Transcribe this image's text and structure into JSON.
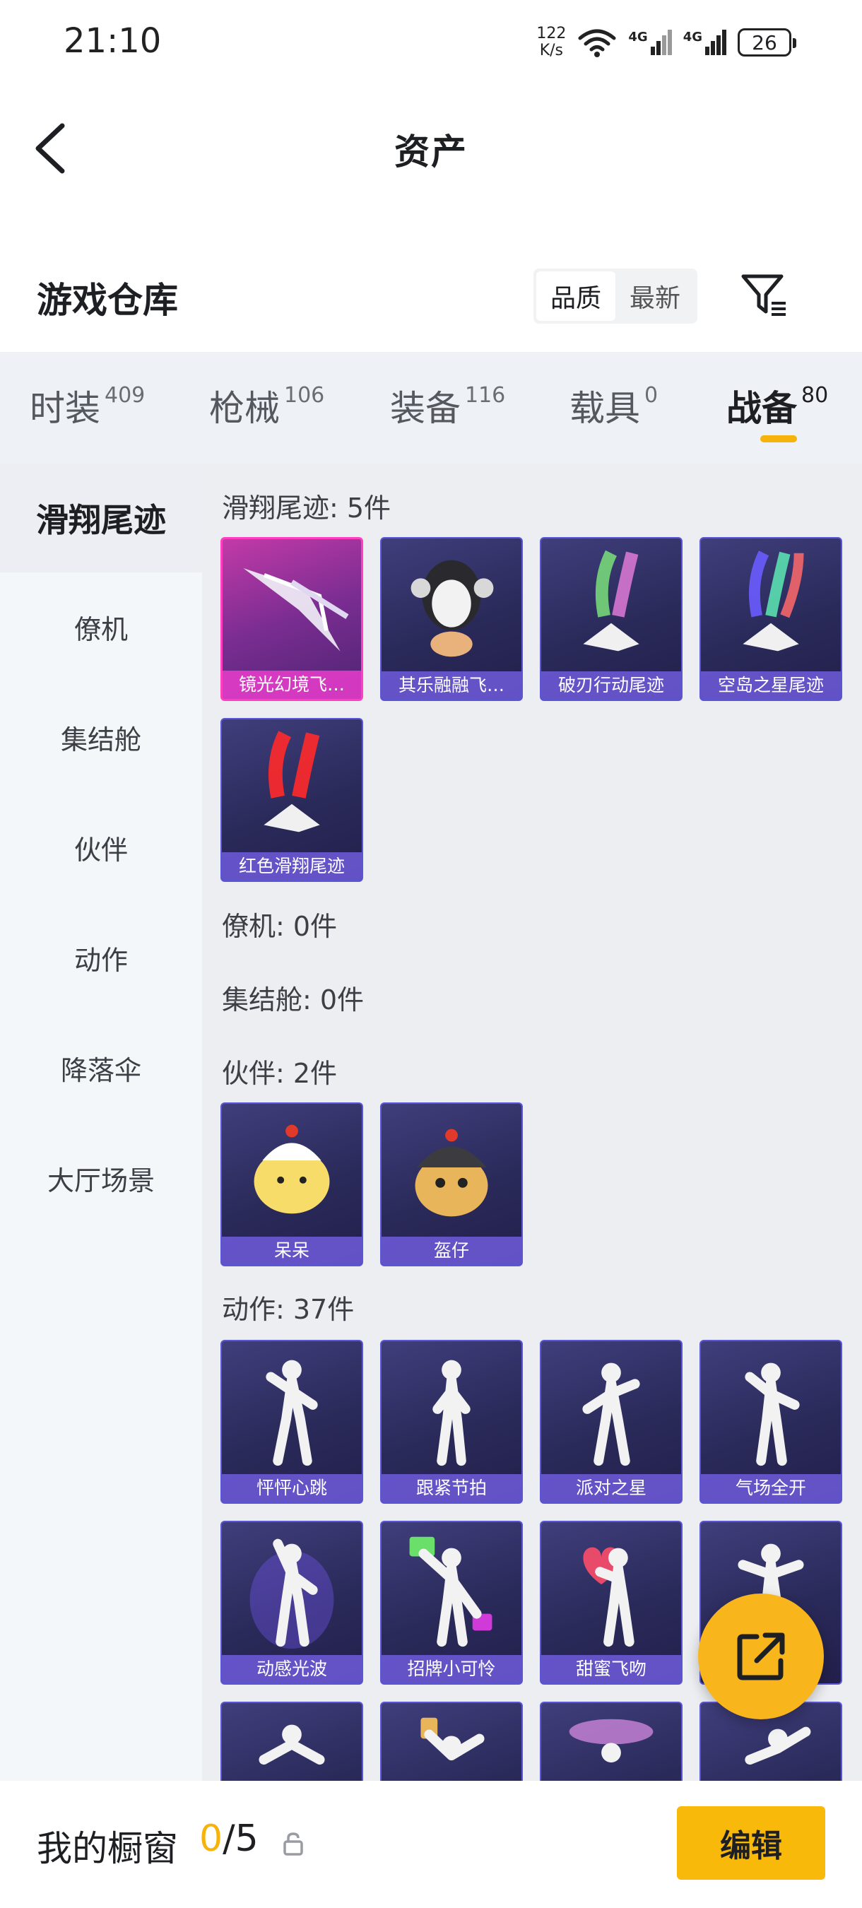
{
  "status_bar": {
    "time": "21:10",
    "net_speed_value": "122",
    "net_speed_unit": "K/s",
    "sim1_label": "4G",
    "sim2_label": "4G",
    "battery": "26"
  },
  "header": {
    "title": "资产"
  },
  "warehouse": {
    "title": "游戏仓库",
    "sort_options": [
      "品质",
      "最新"
    ],
    "sort_selected": "品质"
  },
  "category_tabs": [
    {
      "label": "时装",
      "count": "409"
    },
    {
      "label": "枪械",
      "count": "106"
    },
    {
      "label": "装备",
      "count": "116"
    },
    {
      "label": "载具",
      "count": "0"
    },
    {
      "label": "战备",
      "count": "80",
      "active": true
    }
  ],
  "sidebar": {
    "items": [
      "滑翔尾迹",
      "僚机",
      "集结舱",
      "伙伴",
      "动作",
      "降落伞",
      "大厅场景"
    ],
    "active": "滑翔尾迹"
  },
  "sections": {
    "glide_trail": {
      "title": "滑翔尾迹: 5件",
      "items": [
        "镜光幻境飞…",
        "其乐融融飞…",
        "破刃行动尾迹",
        "空岛之星尾迹",
        "红色滑翔尾迹"
      ]
    },
    "wingman": {
      "title": "僚机: 0件"
    },
    "rally_pod": {
      "title": "集结舱: 0件"
    },
    "companion": {
      "title": "伙伴: 2件",
      "items": [
        "呆呆",
        "盔仔"
      ]
    },
    "emote": {
      "title": "动作: 37件",
      "items": [
        "怦怦心跳",
        "跟紧节拍",
        "派对之星",
        "气场全开",
        "动感光波",
        "招牌小可怜",
        "甜蜜飞吻"
      ]
    }
  },
  "bottom_bar": {
    "showcase_label": "我的橱窗",
    "showcase_current": "0",
    "showcase_total": "/5",
    "edit_label": "编辑"
  },
  "colors": {
    "accent": "#f9b90b",
    "card_border": "#5b56d6",
    "card_selected_border": "#ff3fbf",
    "card_bg": "#2a2a5a"
  },
  "icons": {
    "back": "back-icon",
    "filter": "filter-icon",
    "share": "share-icon",
    "lock": "lock-icon"
  }
}
